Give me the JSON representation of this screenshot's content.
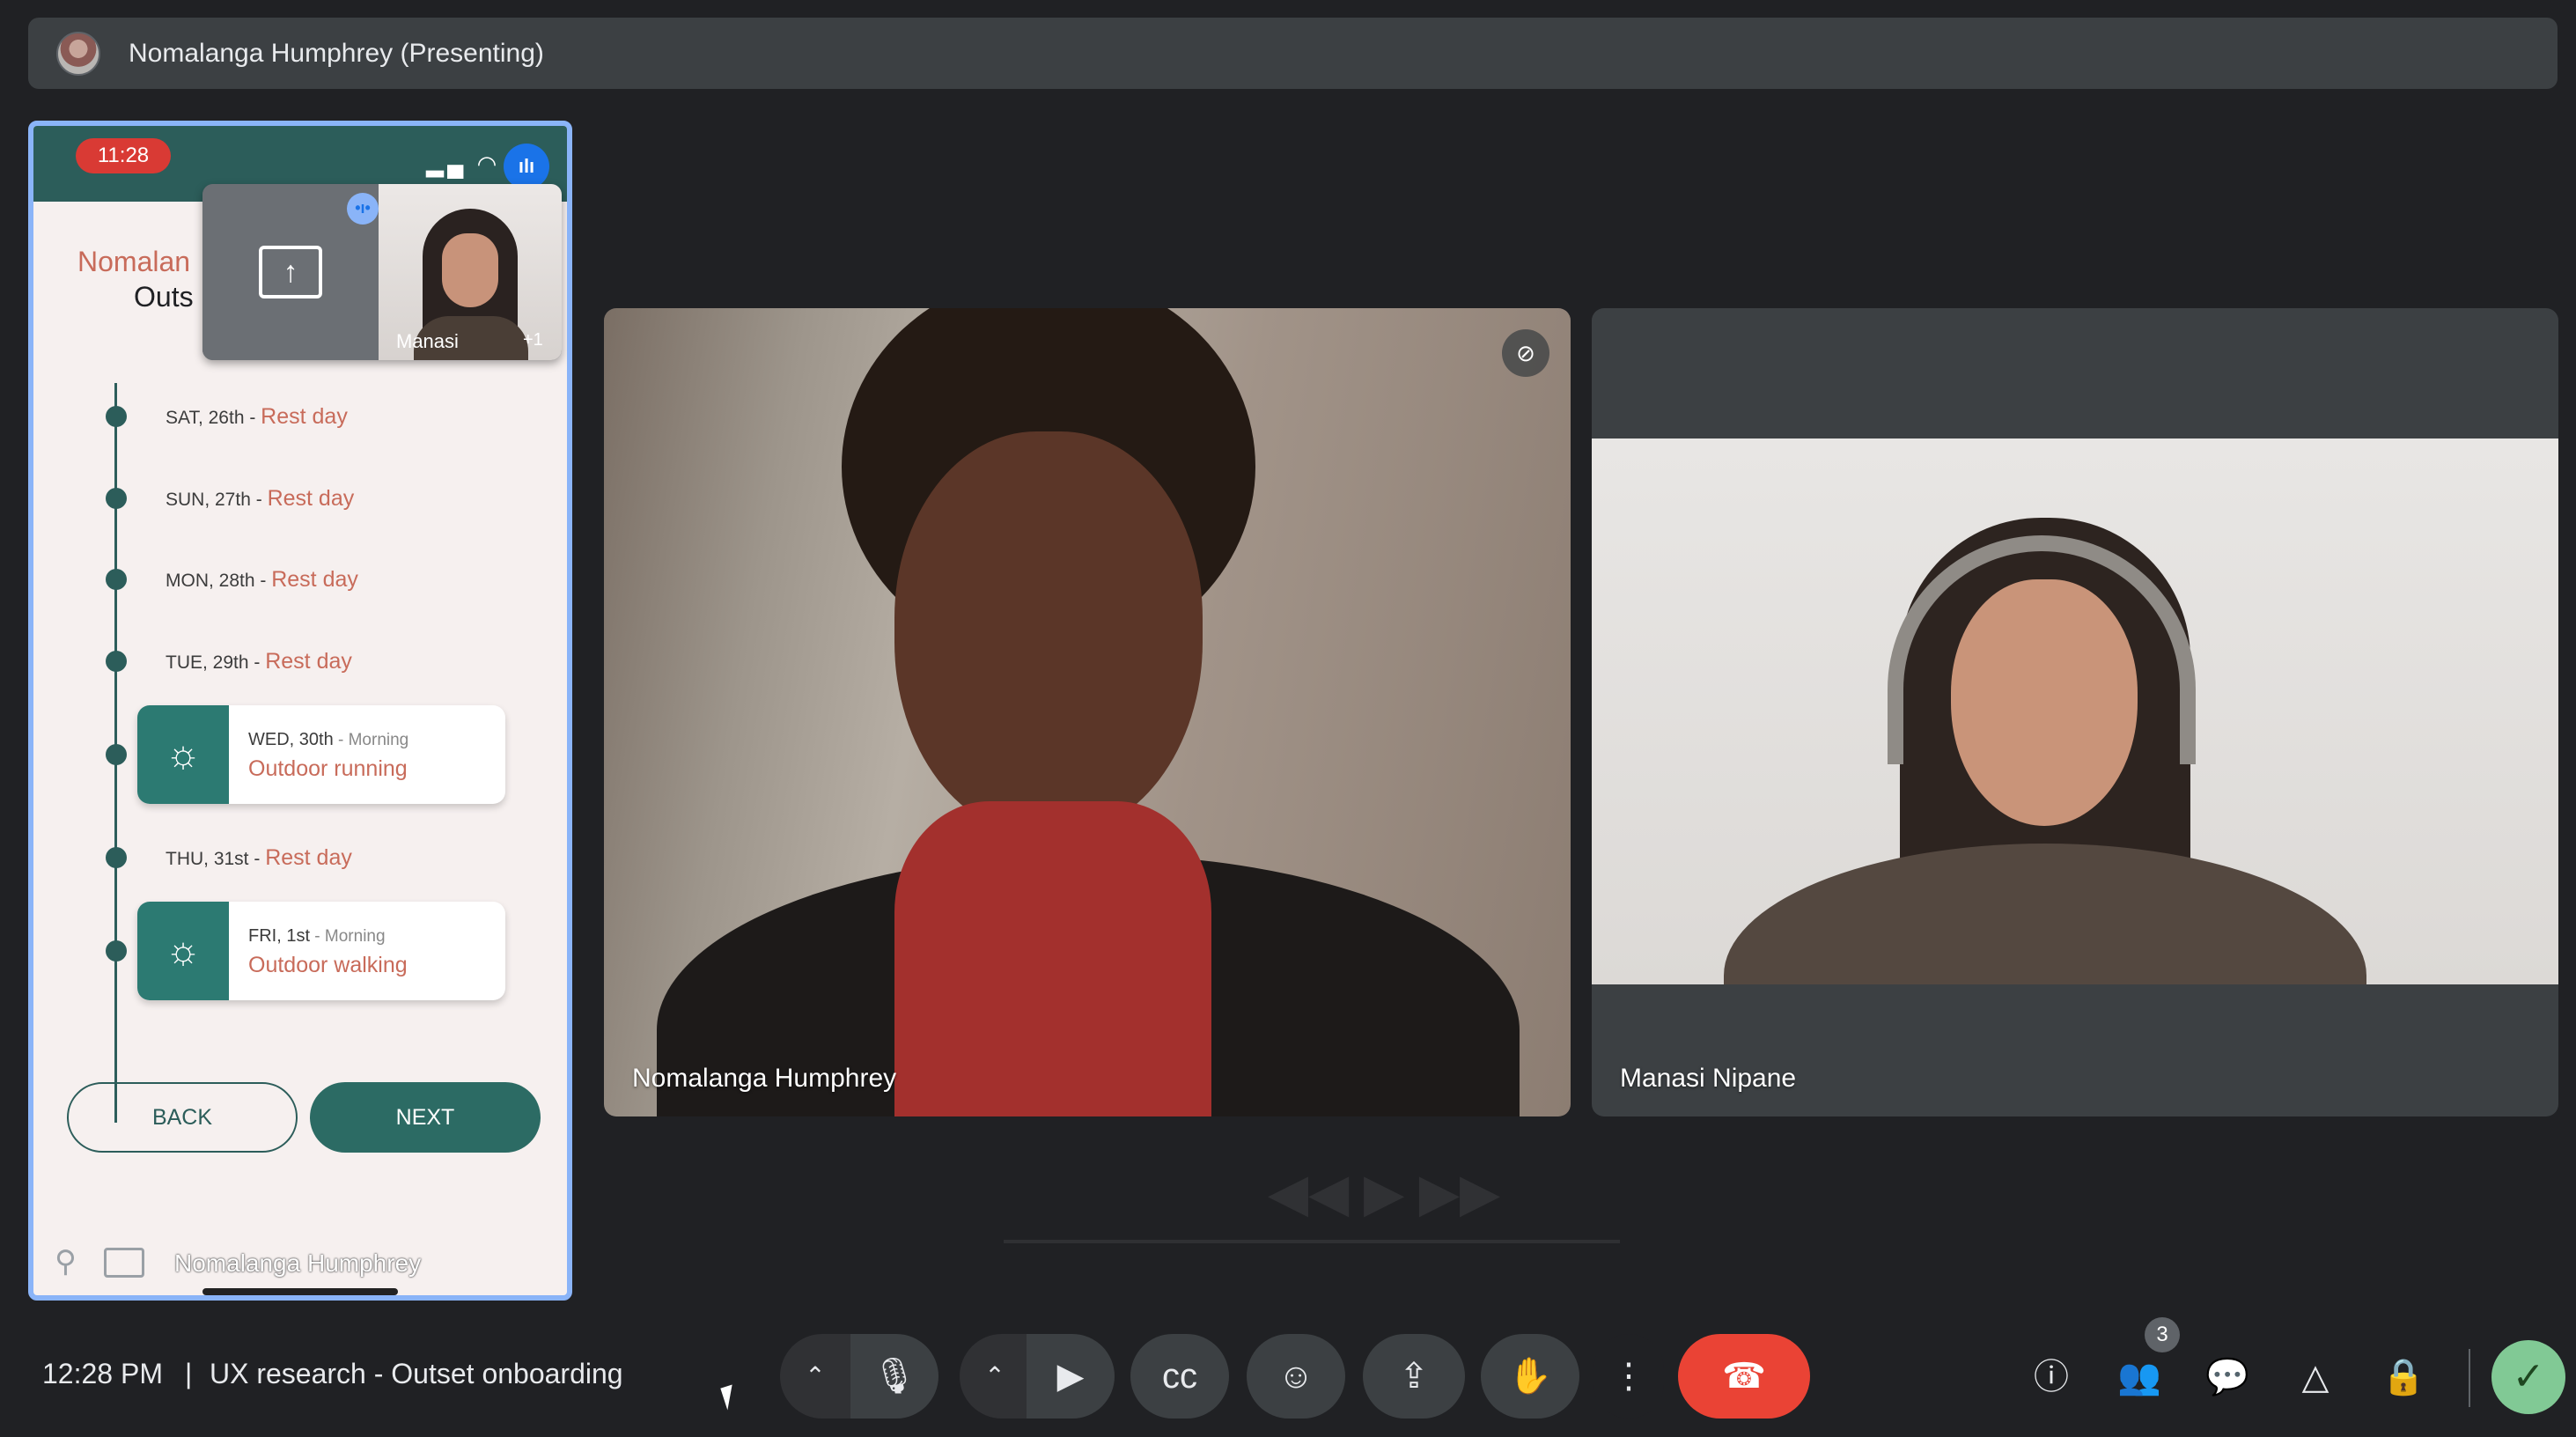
{
  "presenting_bar": {
    "title": "Nomalanga Humphrey (Presenting)"
  },
  "phone": {
    "status_time": "11:28",
    "header_line1": "Nomalan",
    "header_line2": "Outs",
    "pip": {
      "name": "Manasi",
      "extra_count": "+1"
    },
    "schedule": [
      {
        "date": "SAT, 26th",
        "sep": " - ",
        "status": "Rest day"
      },
      {
        "date": "SUN, 27th",
        "sep": " - ",
        "status": "Rest day"
      },
      {
        "date": "MON, 28th",
        "sep": " - ",
        "status": "Rest day"
      },
      {
        "date": "TUE, 29th",
        "sep": " - ",
        "status": "Rest day"
      },
      {
        "date": "WED, 30th",
        "sep": " - ",
        "time_of_day": "Morning",
        "activity": "Outdoor running",
        "icon": "sun-icon"
      },
      {
        "date": "THU, 31st",
        "sep": " - ",
        "status": "Rest day"
      },
      {
        "date": "FRI, 1st",
        "sep": " - ",
        "time_of_day": "Morning",
        "activity": "Outdoor walking",
        "icon": "sun-icon"
      }
    ],
    "back_label": "BACK",
    "next_label": "NEXT",
    "footer_name": "Nomalanga Humphrey"
  },
  "tiles": [
    {
      "name": "Nomalanga Humphrey",
      "muted": true
    },
    {
      "name": "Manasi Nipane"
    }
  ],
  "bottom_bar": {
    "time": "12:28 PM",
    "separator": "|",
    "meeting_title": "UX research - Outset onboarding",
    "participant_count": "3"
  },
  "colors": {
    "accent": "#2c5d5a",
    "end_call": "#ea4335",
    "highlight": "#c86b5a"
  }
}
